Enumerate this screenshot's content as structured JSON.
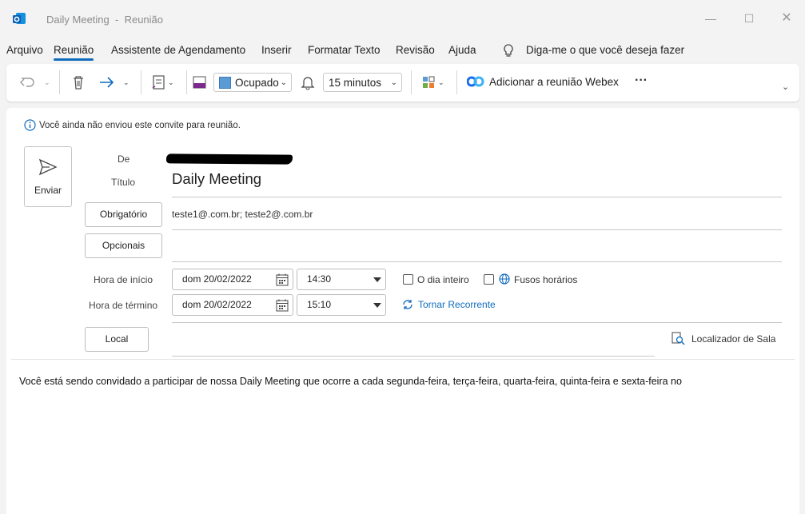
{
  "window": {
    "title": "Daily Meeting",
    "separator": "-",
    "subtitle": "Reunião",
    "minimize_glyph": "—",
    "maximize_glyph": "☐",
    "close_glyph": "✕"
  },
  "menu": {
    "items": [
      {
        "label": "Arquivo"
      },
      {
        "label": "Reunião",
        "active": true
      },
      {
        "label": "Assistente de Agendamento"
      },
      {
        "label": "Inserir"
      },
      {
        "label": "Formatar Texto"
      },
      {
        "label": "Revisão"
      },
      {
        "label": "Ajuda"
      }
    ],
    "tell_me": "Diga-me o que você deseja fazer"
  },
  "ribbon": {
    "show_as": "Ocupado",
    "reminder": "15 minutos",
    "webex": "Adicionar a reunião Webex",
    "more": "···",
    "colors": {
      "busy": "#5b9bd5",
      "forward": "#0f6cbd",
      "categorize_text": "#7b2a8c"
    }
  },
  "form": {
    "info": "Você ainda não enviou este convite para reunião.",
    "send_label": "Enviar",
    "from_label": "De",
    "title_label": "Título",
    "title_value": "Daily Meeting",
    "required_button": "Obrigatório",
    "required_value": "teste1@.com.br; teste2@.com.br",
    "optional_button": "Opcionais",
    "optional_value": "",
    "start_label": "Hora de início",
    "start_date": "dom 20/02/2022",
    "start_time": "14:30",
    "end_label": "Hora de término",
    "end_date": "dom 20/02/2022",
    "end_time": "15:10",
    "all_day": "O dia inteiro",
    "time_zones": "Fusos horários",
    "recurrence": "Tornar Recorrente",
    "location_button": "Local",
    "location_value": "",
    "room_finder": "Localizador de Sala"
  },
  "body": {
    "text": "Você está sendo convidado a participar de nossa Daily Meeting que ocorre a cada segunda-feira, terça-feira, quarta-feira, quinta-feira e sexta-feira no"
  }
}
